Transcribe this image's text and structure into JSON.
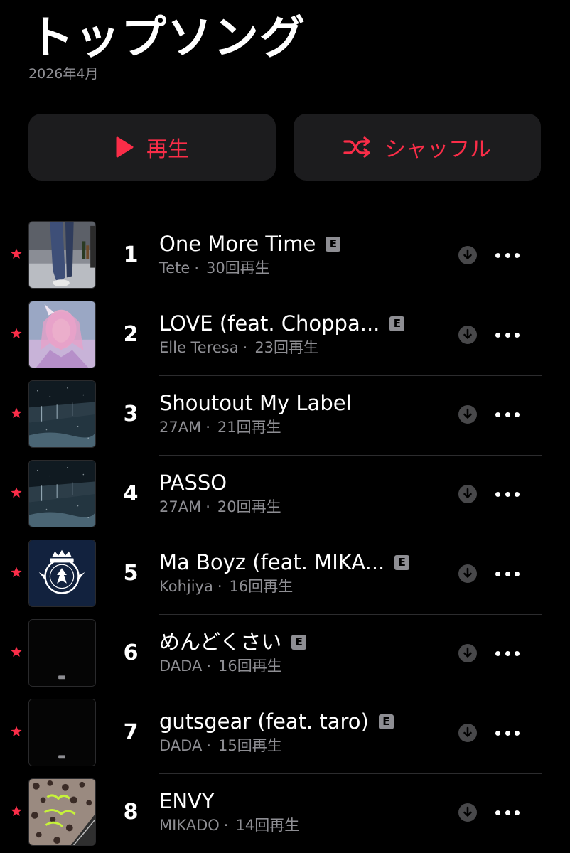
{
  "header": {
    "title": "トップソング",
    "subtitle": "2026年4月"
  },
  "actions": {
    "play_label": "再生",
    "shuffle_label": "シャッフル",
    "accent_color": "#fa2d48"
  },
  "songs": [
    {
      "rank": "1",
      "title": "One More Time",
      "explicit": true,
      "artist": "Tete",
      "plays": "30回再生",
      "starred": true,
      "artwork": "photo-legs"
    },
    {
      "rank": "2",
      "title": "LOVE (feat. Choppa...",
      "explicit": true,
      "artist": "Elle Teresa",
      "plays": "23回再生",
      "starred": true,
      "artwork": "portrait-pink"
    },
    {
      "rank": "3",
      "title": "Shoutout My Label",
      "explicit": false,
      "artist": "27AM",
      "plays": "21回再生",
      "starred": true,
      "artwork": "night-rain"
    },
    {
      "rank": "4",
      "title": "PASSO",
      "explicit": false,
      "artist": "27AM",
      "plays": "20回再生",
      "starred": true,
      "artwork": "night-rain"
    },
    {
      "rank": "5",
      "title": "Ma Boyz (feat. MIKA...",
      "explicit": true,
      "artist": "Kohjiya",
      "plays": "16回再生",
      "starred": true,
      "artwork": "crest-navy"
    },
    {
      "rank": "6",
      "title": "めんどくさい",
      "explicit": true,
      "artist": "DADA",
      "plays": "16回再生",
      "starred": true,
      "artwork": "black"
    },
    {
      "rank": "7",
      "title": "gutsgear (feat. taro)",
      "explicit": true,
      "artist": "DADA",
      "plays": "15回再生",
      "starred": true,
      "artwork": "black"
    },
    {
      "rank": "8",
      "title": "ENVY",
      "explicit": false,
      "artist": "MIKADO",
      "plays": "14回再生",
      "starred": true,
      "artwork": "leopard"
    }
  ],
  "icons": {
    "explicit_badge": "E",
    "star": "star-icon",
    "download": "download-icon",
    "more": "more-icon"
  }
}
